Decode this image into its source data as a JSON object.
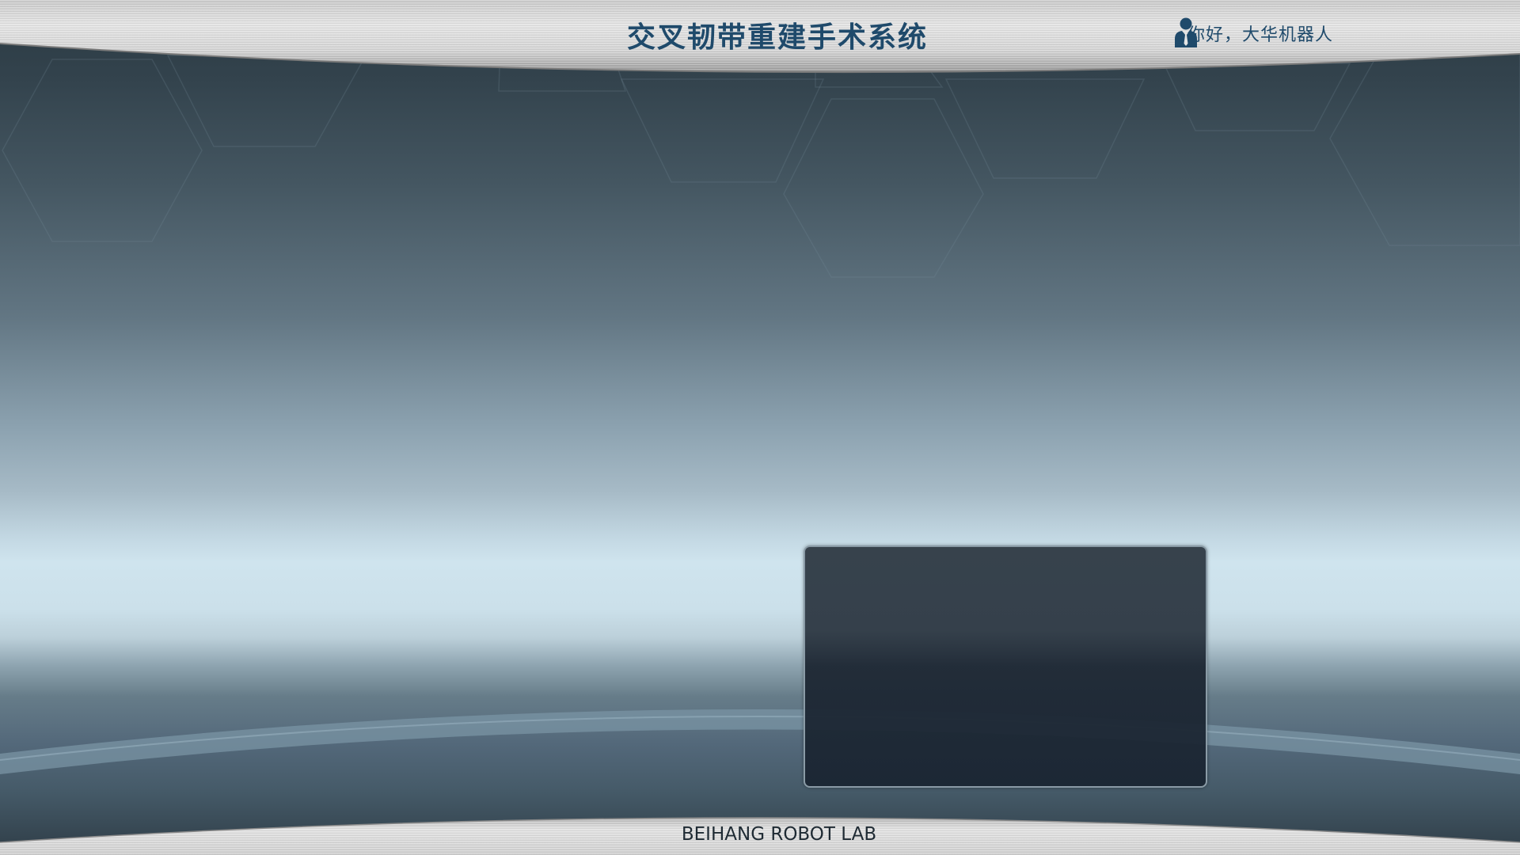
{
  "header": {
    "title": "交叉韧带重建手术系统",
    "greeting": "你好，大华机器人"
  },
  "footer": {
    "lab_name": "BEIHANG ROBOT LAB"
  },
  "icons": {
    "user": "user-icon"
  },
  "colors": {
    "title_text": "#1f4a6b",
    "background_top": "#2a3942",
    "background_glow": "#cfe4ee",
    "panel": "#343f49",
    "metal_bar": "#d6d6d6"
  }
}
